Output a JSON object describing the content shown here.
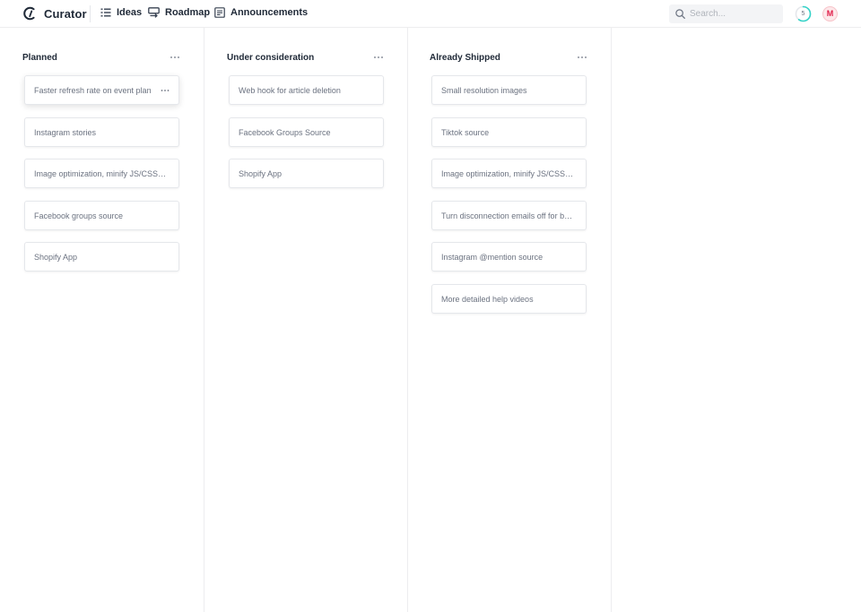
{
  "brand": {
    "name": "Curator",
    "accent": "#1f2937"
  },
  "nav": {
    "ideas": "Ideas",
    "roadmap": "Roadmap",
    "announcements": "Announcements"
  },
  "search": {
    "placeholder": "Search..."
  },
  "progress": {
    "count": "5",
    "value": 0.6,
    "color": "#34d3c8"
  },
  "avatar": {
    "initial": "M",
    "color": "#e11d48"
  },
  "columns": [
    {
      "title": "Planned",
      "cards": [
        "Faster refresh rate on event plan",
        "Instagram stories",
        "Image optimization, minify JS/CSS, fix layout shifts",
        "Facebook groups source",
        "Shopify App"
      ]
    },
    {
      "title": "Under consideration",
      "cards": [
        "Web hook for article deletion",
        "Facebook Groups Source",
        "Shopify App"
      ]
    },
    {
      "title": "Already Shipped",
      "cards": [
        "Small resolution images",
        "Tiktok source",
        "Image optimization, minify JS/CSS, fix layout shifts",
        "Turn disconnection emails off for brands",
        "Instagram @mention source",
        "More detailed help videos"
      ]
    }
  ]
}
